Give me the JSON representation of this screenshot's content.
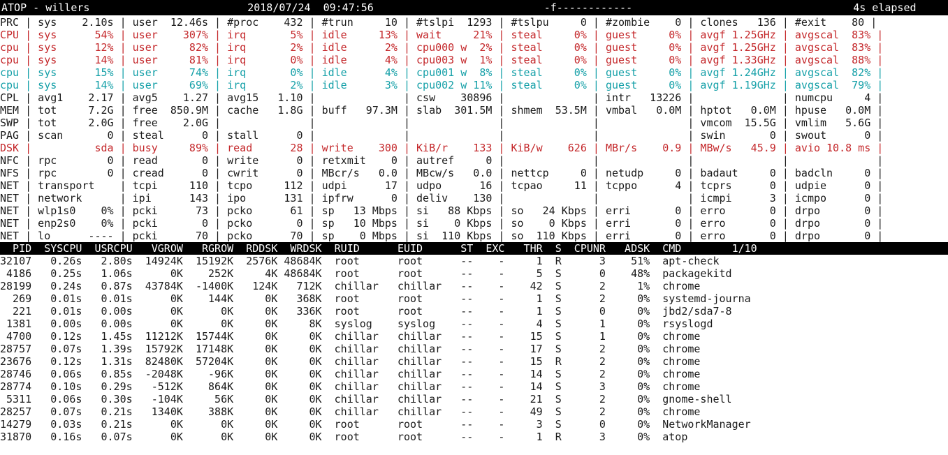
{
  "header": {
    "app": "ATOP - willers",
    "date": "2018/07/24",
    "time": "09:47:56",
    "flags": "-f------------",
    "elapsed": "4s elapsed"
  },
  "system_lines": [
    {
      "color": "",
      "text": "PRC | sys    2.10s | user  12.46s | #proc    432 | #trun     10 | #tslpi  1293 | #tslpu     0 | #zombie    0 | clones   136 | #exit    80 |"
    },
    {
      "color": "red",
      "text": "CPU | sys      54% | user    307% | irq       5% | idle     13% | wait     21% | steal     0% | guest     0% | avgf 1.25GHz | avgscal  83% |"
    },
    {
      "color": "red",
      "text": "cpu | sys      12% | user     82% | irq       2% | idle      2% | cpu000 w  2% | steal     0% | guest     0% | avgf 1.25GHz | avgscal  83% |"
    },
    {
      "color": "red",
      "text": "cpu | sys      14% | user     81% | irq       0% | idle      4% | cpu003 w  1% | steal     0% | guest     0% | avgf 1.33GHz | avgscal  88% |"
    },
    {
      "color": "cyan",
      "text": "cpu | sys      15% | user     74% | irq       0% | idle      4% | cpu001 w  8% | steal     0% | guest     0% | avgf 1.24GHz | avgscal  82% |"
    },
    {
      "color": "cyan",
      "text": "cpu | sys      14% | user     69% | irq       2% | idle      3% | cpu002 w 11% | steal     0% | guest     0% | avgf 1.19GHz | avgscal  79% |"
    },
    {
      "color": "",
      "text": "CPL | avg1    2.17 | avg5    1.27 | avg15   1.10 |              | csw    30896 |              | intr   13226 |              | numcpu     4 |"
    },
    {
      "color": "",
      "text": "MEM | tot     7.2G | free  850.9M | cache   1.8G | buff   97.3M | slab  301.5M | shmem  53.5M | vmbal   0.0M | hptot   0.0M | hpuse   0.0M |"
    },
    {
      "color": "",
      "text": "SWP | tot     2.0G | free    2.0G |              |              |              |              |              | vmcom  15.5G | vmlim   5.6G |"
    },
    {
      "color": "",
      "text": "PAG | scan       0 | steal      0 | stall      0 |              |              |              |              | swin       0 | swout      0 |"
    },
    {
      "color": "red",
      "text": "DSK |          sda | busy     89% | read      28 | write    300 | KiB/r    133 | KiB/w    626 | MBr/s    0.9 | MBw/s   45.9 | avio 10.8 ms |"
    },
    {
      "color": "",
      "text": "NFC | rpc        0 | read       0 | write      0 | retxmit    0 | autref     0 |              |              |              |              |"
    },
    {
      "color": "",
      "text": "NFS | rpc        0 | cread      0 | cwrit      0 | MBcr/s   0.0 | MBcw/s   0.0 | nettcp     0 | netudp     0 | badaut     0 | badcln     0 |"
    },
    {
      "color": "",
      "text": "NET | transport    | tcpi     110 | tcpo     112 | udpi      17 | udpo      16 | tcpao     11 | tcppo      4 | tcprs      0 | udpie      0 |"
    },
    {
      "color": "",
      "text": "NET | network      | ipi      143 | ipo      131 | ipfrw      0 | deliv    130 |              |              | icmpi      3 | icmpo      0 |"
    },
    {
      "color": "",
      "text": "NET | wlp1s0    0% | pcki      73 | pcko      61 | sp   13 Mbps | si   88 Kbps | so   24 Kbps | erri       0 | erro       0 | drpo       0 |"
    },
    {
      "color": "",
      "text": "NET | enp2s0    0% | pcki       0 | pcko       0 | sp   10 Mbps | si    0 Kbps | so    0 Kbps | erri       0 | erro       0 | drpo       0 |"
    },
    {
      "color": "",
      "text": "NET | lo      ---- | pcki      70 | pcko      70 | sp    0 Mbps | si  110 Kbps | so  110 Kbps | erri       0 | erro       0 | drpo       0 |"
    }
  ],
  "process_header": "  PID  SYSCPU  USRCPU   VGROW   RGROW  RDDSK  WRDSK  RUID      EUID      ST  EXC   THR  S  CPUNR   ADSK  CMD        1/10",
  "process_rows": [
    "32107   0.26s   2.80s  14924K  15192K  2576K 48684K  root      root      --    -     1  R      3    51%  apt-check",
    " 4186   0.25s   1.06s      0K    252K     4K 48684K  root      root      --    -     5  S      0    48%  packagekitd",
    "28199   0.24s   0.87s  43784K  -1400K   124K   712K  chillar   chillar   --    -    42  S      2     1%  chrome",
    "  269   0.01s   0.01s      0K    144K     0K   368K  root      root      --    -     1  S      2     0%  systemd-journa",
    "  221   0.01s   0.00s      0K      0K     0K   336K  root      root      --    -     1  S      0     0%  jbd2/sda7-8",
    " 1381   0.00s   0.00s      0K      0K     0K     8K  syslog    syslog    --    -     4  S      1     0%  rsyslogd",
    " 4700   0.12s   1.45s  11212K  15744K     0K     0K  chillar   chillar   --    -    15  S      1     0%  chrome",
    "28757   0.07s   1.39s  15792K  17148K     0K     0K  chillar   chillar   --    -    17  S      2     0%  chrome",
    "23676   0.12s   1.31s  82480K  57204K     0K     0K  chillar   chillar   --    -    15  R      2     0%  chrome",
    "28746   0.06s   0.85s  -2048K    -96K     0K     0K  chillar   chillar   --    -    14  S      2     0%  chrome",
    "28774   0.10s   0.29s   -512K    864K     0K     0K  chillar   chillar   --    -    14  S      3     0%  chrome",
    " 5311   0.06s   0.30s   -104K     56K     0K     0K  chillar   chillar   --    -    21  S      2     0%  gnome-shell",
    "28257   0.07s   0.21s   1340K    388K     0K     0K  chillar   chillar   --    -    49  S      2     0%  chrome",
    "14279   0.03s   0.21s      0K      0K     0K     0K  root      root      --    -     3  S      0     0%  NetworkManager",
    "31870   0.16s   0.07s      0K      0K     0K     0K  root      root      --    -     1  R      3     0%  atop"
  ]
}
